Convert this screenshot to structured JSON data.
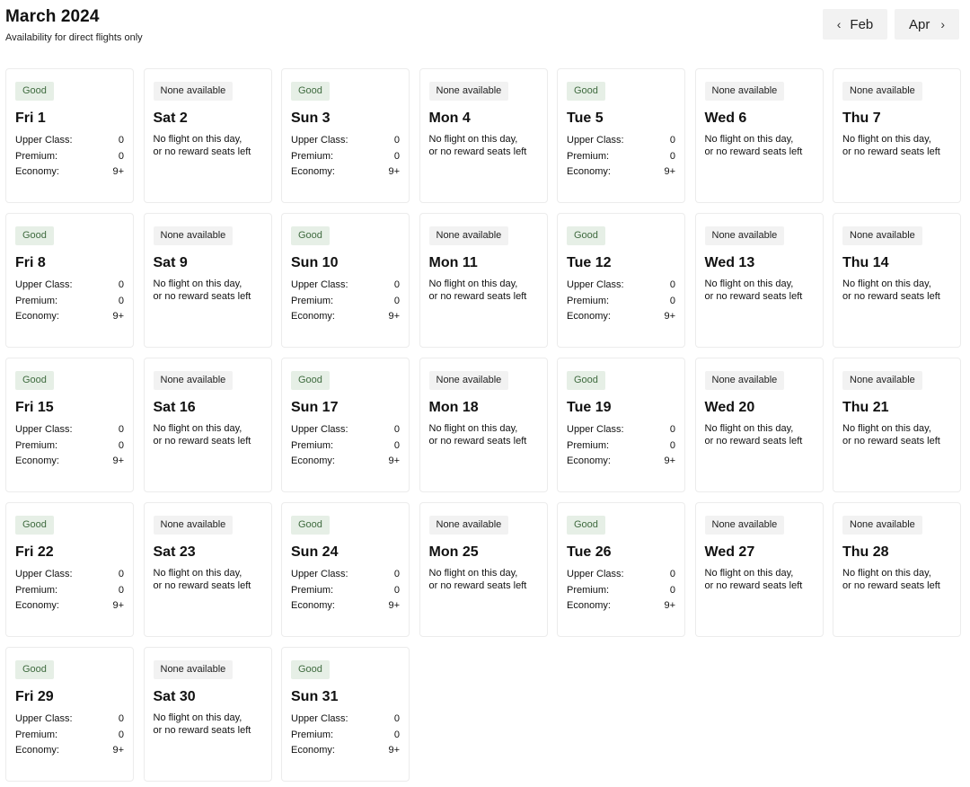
{
  "header": {
    "title": "March 2024",
    "subtitle": "Availability for direct flights only"
  },
  "nav": {
    "prev_label": "Feb",
    "next_label": "Apr",
    "prev_icon": "chevron-left-icon",
    "next_icon": "chevron-right-icon"
  },
  "labels": {
    "upper": "Upper Class:",
    "premium": "Premium:",
    "economy": "Economy:"
  },
  "colors": {
    "good_badge_bg": "#e6efe6",
    "good_badge_text": "#3f6b3f",
    "none_badge_bg": "#f2f2f2"
  },
  "days": [
    {
      "title": "Fri 1",
      "status": "Good",
      "type": "good",
      "upper": "0",
      "premium": "0",
      "economy": "9+"
    },
    {
      "title": "Sat 2",
      "status": "None available",
      "type": "none",
      "line1": "No flight on this day,",
      "line2": "or no reward seats left"
    },
    {
      "title": "Sun 3",
      "status": "Good",
      "type": "good",
      "upper": "0",
      "premium": "0",
      "economy": "9+"
    },
    {
      "title": "Mon 4",
      "status": "None available",
      "type": "none",
      "line1": "No flight on this day,",
      "line2": "or no reward seats left"
    },
    {
      "title": "Tue 5",
      "status": "Good",
      "type": "good",
      "upper": "0",
      "premium": "0",
      "economy": "9+"
    },
    {
      "title": "Wed 6",
      "status": "None available",
      "type": "none",
      "line1": "No flight on this day,",
      "line2": "or no reward seats left"
    },
    {
      "title": "Thu 7",
      "status": "None available",
      "type": "none",
      "line1": "No flight on this day,",
      "line2": "or no reward seats left"
    },
    {
      "title": "Fri 8",
      "status": "Good",
      "type": "good",
      "upper": "0",
      "premium": "0",
      "economy": "9+"
    },
    {
      "title": "Sat 9",
      "status": "None available",
      "type": "none",
      "line1": "No flight on this day,",
      "line2": "or no reward seats left"
    },
    {
      "title": "Sun 10",
      "status": "Good",
      "type": "good",
      "upper": "0",
      "premium": "0",
      "economy": "9+"
    },
    {
      "title": "Mon 11",
      "status": "None available",
      "type": "none",
      "line1": "No flight on this day,",
      "line2": "or no reward seats left"
    },
    {
      "title": "Tue 12",
      "status": "Good",
      "type": "good",
      "upper": "0",
      "premium": "0",
      "economy": "9+"
    },
    {
      "title": "Wed 13",
      "status": "None available",
      "type": "none",
      "line1": "No flight on this day,",
      "line2": "or no reward seats left"
    },
    {
      "title": "Thu 14",
      "status": "None available",
      "type": "none",
      "line1": "No flight on this day,",
      "line2": "or no reward seats left"
    },
    {
      "title": "Fri 15",
      "status": "Good",
      "type": "good",
      "upper": "0",
      "premium": "0",
      "economy": "9+"
    },
    {
      "title": "Sat 16",
      "status": "None available",
      "type": "none",
      "line1": "No flight on this day,",
      "line2": "or no reward seats left"
    },
    {
      "title": "Sun 17",
      "status": "Good",
      "type": "good",
      "upper": "0",
      "premium": "0",
      "economy": "9+"
    },
    {
      "title": "Mon 18",
      "status": "None available",
      "type": "none",
      "line1": "No flight on this day,",
      "line2": "or no reward seats left"
    },
    {
      "title": "Tue 19",
      "status": "Good",
      "type": "good",
      "upper": "0",
      "premium": "0",
      "economy": "9+"
    },
    {
      "title": "Wed 20",
      "status": "None available",
      "type": "none",
      "line1": "No flight on this day,",
      "line2": "or no reward seats left"
    },
    {
      "title": "Thu 21",
      "status": "None available",
      "type": "none",
      "line1": "No flight on this day,",
      "line2": "or no reward seats left"
    },
    {
      "title": "Fri 22",
      "status": "Good",
      "type": "good",
      "upper": "0",
      "premium": "0",
      "economy": "9+"
    },
    {
      "title": "Sat 23",
      "status": "None available",
      "type": "none",
      "line1": "No flight on this day,",
      "line2": "or no reward seats left"
    },
    {
      "title": "Sun 24",
      "status": "Good",
      "type": "good",
      "upper": "0",
      "premium": "0",
      "economy": "9+"
    },
    {
      "title": "Mon 25",
      "status": "None available",
      "type": "none",
      "line1": "No flight on this day,",
      "line2": "or no reward seats left"
    },
    {
      "title": "Tue 26",
      "status": "Good",
      "type": "good",
      "upper": "0",
      "premium": "0",
      "economy": "9+"
    },
    {
      "title": "Wed 27",
      "status": "None available",
      "type": "none",
      "line1": "No flight on this day,",
      "line2": "or no reward seats left"
    },
    {
      "title": "Thu 28",
      "status": "None available",
      "type": "none",
      "line1": "No flight on this day,",
      "line2": "or no reward seats left"
    },
    {
      "title": "Fri 29",
      "status": "Good",
      "type": "good",
      "upper": "0",
      "premium": "0",
      "economy": "9+"
    },
    {
      "title": "Sat 30",
      "status": "None available",
      "type": "none",
      "line1": "No flight on this day,",
      "line2": "or no reward seats left"
    },
    {
      "title": "Sun 31",
      "status": "Good",
      "type": "good",
      "upper": "0",
      "premium": "0",
      "economy": "9+"
    }
  ]
}
